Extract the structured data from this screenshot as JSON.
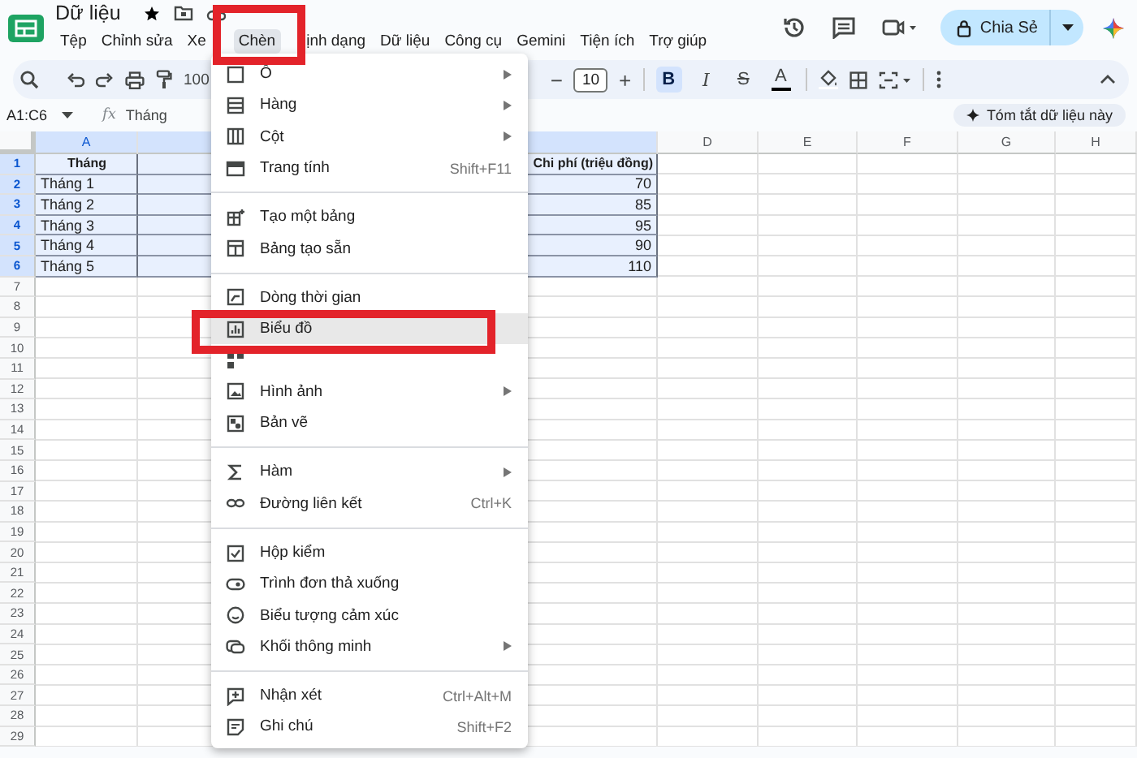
{
  "document": {
    "title": "Dữ liệu"
  },
  "menubar": [
    {
      "label": "Tệp",
      "selected": false,
      "annotated": false
    },
    {
      "label": "Chỉnh sửa",
      "selected": false,
      "annotated": false
    },
    {
      "label": "Xe",
      "selected": false,
      "annotated": false
    },
    {
      "label": "Chèn",
      "selected": true,
      "annotated": true
    },
    {
      "label": "ịnh dạng",
      "selected": false,
      "annotated": false
    },
    {
      "label": "Dữ liệu",
      "selected": false,
      "annotated": false
    },
    {
      "label": "Công cụ",
      "selected": false,
      "annotated": false
    },
    {
      "label": "Gemini",
      "selected": false,
      "annotated": false
    },
    {
      "label": "Tiện ích",
      "selected": false,
      "annotated": false
    },
    {
      "label": "Trợ giúp",
      "selected": false,
      "annotated": false
    }
  ],
  "share_button": {
    "label": "Chia Sẻ"
  },
  "toolbar": {
    "zoom": "100",
    "font_size_buttons": [
      "−",
      "+"
    ],
    "font_size": "10",
    "format_buttons": [
      {
        "kind": "bold",
        "label": "B",
        "selected": true
      },
      {
        "kind": "italic",
        "label": "I",
        "selected": false
      },
      {
        "kind": "strike",
        "label": "S",
        "selected": false
      },
      {
        "kind": "color",
        "label": "A",
        "selected": false
      }
    ]
  },
  "formula_bar": {
    "range": "A1:C6",
    "fx": "fx",
    "content": "Tháng",
    "summary_button": "Tóm tắt dữ liệu này"
  },
  "columns": [
    {
      "label": "A",
      "selected": true
    },
    {
      "selected": true
    },
    {
      "selected": true
    },
    {
      "label": "D",
      "selected": false
    },
    {
      "label": "E",
      "selected": false
    },
    {
      "label": "F",
      "selected": false
    },
    {
      "label": "G",
      "selected": false
    },
    {
      "label": "H",
      "selected": false
    }
  ],
  "rows": [
    {
      "number": "1",
      "selected": true,
      "kind": "header",
      "cells": {
        "A": "Tháng",
        "C": "Chi phí (triệu đồng)"
      }
    },
    {
      "number": "2",
      "selected": true,
      "kind": "data",
      "cells": {
        "A": "Tháng 1",
        "C": "70"
      }
    },
    {
      "number": "3",
      "selected": true,
      "kind": "data",
      "cells": {
        "A": "Tháng 2",
        "C": "85"
      }
    },
    {
      "number": "4",
      "selected": true,
      "kind": "data",
      "cells": {
        "A": "Tháng 3",
        "C": "95"
      }
    },
    {
      "number": "5",
      "selected": true,
      "kind": "data",
      "cells": {
        "A": "Tháng 4",
        "C": "90"
      }
    },
    {
      "number": "6",
      "selected": true,
      "kind": "data",
      "cells": {
        "A": "Tháng 5",
        "C": "110"
      }
    },
    {
      "number": "7",
      "selected": false,
      "kind": "empty"
    },
    {
      "number": "8",
      "selected": false,
      "kind": "empty"
    },
    {
      "number": "9",
      "selected": false,
      "kind": "empty"
    },
    {
      "number": "10",
      "selected": false,
      "kind": "empty"
    },
    {
      "number": "11",
      "selected": false,
      "kind": "empty"
    },
    {
      "number": "12",
      "selected": false,
      "kind": "empty"
    },
    {
      "number": "13",
      "selected": false,
      "kind": "empty"
    },
    {
      "number": "14",
      "selected": false,
      "kind": "empty"
    },
    {
      "number": "15",
      "selected": false,
      "kind": "empty"
    },
    {
      "number": "16",
      "selected": false,
      "kind": "empty"
    },
    {
      "number": "17",
      "selected": false,
      "kind": "empty"
    },
    {
      "number": "18",
      "selected": false,
      "kind": "empty"
    },
    {
      "number": "19",
      "selected": false,
      "kind": "empty"
    },
    {
      "number": "20",
      "selected": false,
      "kind": "empty"
    },
    {
      "number": "21",
      "selected": false,
      "kind": "empty"
    },
    {
      "number": "22",
      "selected": false,
      "kind": "empty"
    },
    {
      "number": "23",
      "selected": false,
      "kind": "empty"
    },
    {
      "number": "24",
      "selected": false,
      "kind": "empty"
    },
    {
      "number": "25",
      "selected": false,
      "kind": "empty"
    },
    {
      "number": "26",
      "selected": false,
      "kind": "empty"
    },
    {
      "number": "27",
      "selected": false,
      "kind": "empty"
    },
    {
      "number": "28",
      "selected": false,
      "kind": "empty"
    },
    {
      "number": "29",
      "selected": false,
      "kind": "empty"
    }
  ],
  "menu": {
    "groups": [
      [
        {
          "label": "Ô",
          "submenu": true,
          "hovered": false,
          "annotated": false
        },
        {
          "label": "Hàng",
          "submenu": true,
          "hovered": false,
          "annotated": false
        },
        {
          "label": "Cột",
          "submenu": true,
          "hovered": false,
          "annotated": false
        },
        {
          "label": "Trang tính",
          "shortcut": "Shift+F11",
          "submenu": false,
          "hovered": false,
          "annotated": false
        }
      ],
      [
        {
          "label": "Tạo một bảng",
          "submenu": false,
          "hovered": false,
          "annotated": false
        },
        {
          "label": "Bảng tạo sẵn",
          "submenu": false,
          "hovered": false,
          "annotated": false
        }
      ],
      [
        {
          "label": "Dòng thời gian",
          "submenu": false,
          "hovered": false,
          "annotated": false
        },
        {
          "label": "Biểu đồ",
          "submenu": false,
          "hovered": true,
          "annotated": true
        },
        {
          "submenu": false,
          "hovered": false,
          "annotated": false
        },
        {
          "label": "Hình ảnh",
          "submenu": true,
          "hovered": false,
          "annotated": false
        },
        {
          "label": "Bản vẽ",
          "submenu": false,
          "hovered": false,
          "annotated": false
        }
      ],
      [
        {
          "label": "Hàm",
          "submenu": true,
          "hovered": false,
          "annotated": false
        },
        {
          "label": "Đường liên kết",
          "shortcut": "Ctrl+K",
          "submenu": false,
          "hovered": false,
          "annotated": false
        }
      ],
      [
        {
          "label": "Hộp kiểm",
          "submenu": false,
          "hovered": false,
          "annotated": false
        },
        {
          "label": "Trình đơn thả xuống",
          "submenu": false,
          "hovered": false,
          "annotated": false
        },
        {
          "label": "Biểu tượng cảm xúc",
          "submenu": false,
          "hovered": false,
          "annotated": false
        },
        {
          "label": "Khối thông minh",
          "submenu": true,
          "hovered": false,
          "annotated": false
        }
      ],
      [
        {
          "label": "Nhận xét",
          "shortcut": "Ctrl+Alt+M",
          "submenu": false,
          "hovered": false,
          "annotated": false
        },
        {
          "label": "Ghi chú",
          "shortcut": "Shift+F2",
          "submenu": false,
          "hovered": false,
          "annotated": false
        }
      ]
    ]
  }
}
